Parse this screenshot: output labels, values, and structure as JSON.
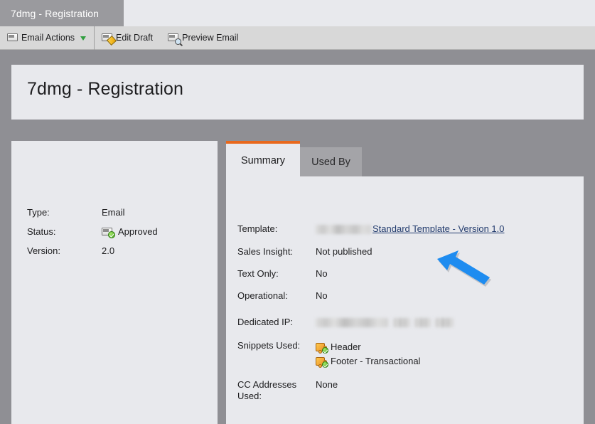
{
  "window": {
    "tab_title": "7dmg - Registration"
  },
  "toolbar": {
    "items": [
      {
        "label": "Email Actions",
        "icon": "envelope-icon",
        "has_caret": true
      },
      {
        "label": "Edit Draft",
        "icon": "envelope-pencil-icon",
        "has_caret": false
      },
      {
        "label": "Preview Email",
        "icon": "envelope-magnifier-icon",
        "has_caret": false
      }
    ]
  },
  "page": {
    "title": "7dmg - Registration"
  },
  "left_panel": {
    "rows": [
      {
        "key": "Type:",
        "value": "Email",
        "icon": null
      },
      {
        "key": "Status:",
        "value": "Approved",
        "icon": "envelope-approved-icon"
      },
      {
        "key": "Version:",
        "value": "2.0",
        "icon": null
      }
    ]
  },
  "tabs": [
    {
      "label": "Summary",
      "active": true
    },
    {
      "label": "Used By",
      "active": false
    }
  ],
  "summary": {
    "template": {
      "key": "Template:",
      "redacted": true,
      "link_text": "Standard Template - Version 1.0"
    },
    "sales_insight": {
      "key": "Sales Insight:",
      "value": "Not published"
    },
    "text_only": {
      "key": "Text Only:",
      "value": "No"
    },
    "operational": {
      "key": "Operational:",
      "value": "No"
    },
    "dedicated_ip": {
      "key": "Dedicated IP:",
      "value": "",
      "redacted": true
    },
    "snippets_used": {
      "key": "Snippets Used:",
      "items": [
        {
          "label": "Header",
          "icon": "snippet-icon"
        },
        {
          "label": "Footer - Transactional",
          "icon": "snippet-icon"
        }
      ]
    },
    "cc_addresses_used": {
      "key_line1": "CC Addresses",
      "key_line2": "Used:",
      "value": "None"
    }
  },
  "annotation": {
    "arrow": "blue-arrow-pointing-up-left",
    "color": "#1e8cf0"
  },
  "colors": {
    "accent_orange": "#e8681c",
    "panel_bg": "#e8e9ed",
    "page_bg": "#8f8f94",
    "toolbar_bg": "#d8d8d8",
    "link": "#233c6e",
    "arrow_blue": "#1e8cf0"
  }
}
